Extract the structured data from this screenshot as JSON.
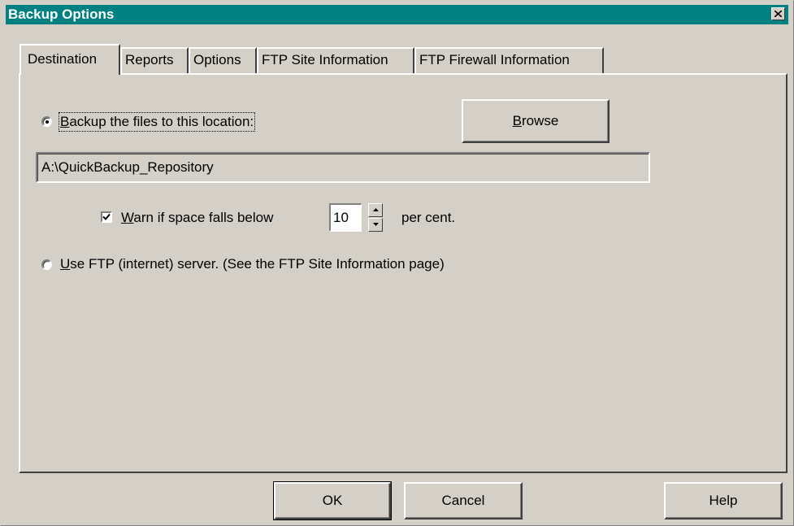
{
  "window": {
    "title": "Backup Options"
  },
  "tabs": [
    {
      "label": "Destination"
    },
    {
      "label": "Reports"
    },
    {
      "label": "Options"
    },
    {
      "label": "FTP Site Information"
    },
    {
      "label": "FTP Firewall Information"
    }
  ],
  "destination": {
    "radio_local": {
      "accel": "B",
      "rest": "ackup the files to this location:",
      "selected": true
    },
    "browse": {
      "accel": "B",
      "rest": "rowse"
    },
    "path_value": "A:\\QuickBackup_Repository",
    "warn": {
      "accel": "W",
      "rest": "arn if space falls below",
      "checked": true
    },
    "warn_value": "10",
    "unit": "per cent.",
    "radio_ftp": {
      "accel": "U",
      "rest": "se FTP (internet) server.  (See the FTP Site Information page)",
      "selected": false
    }
  },
  "buttons": {
    "ok": "OK",
    "cancel": "Cancel",
    "help": "Help"
  },
  "icons": {
    "close": "close-icon",
    "spin_up": "arrow-up-icon",
    "spin_down": "arrow-down-icon",
    "check": "check-icon"
  },
  "colors": {
    "titlebar": "#008080",
    "face": "#d4d0c8"
  }
}
